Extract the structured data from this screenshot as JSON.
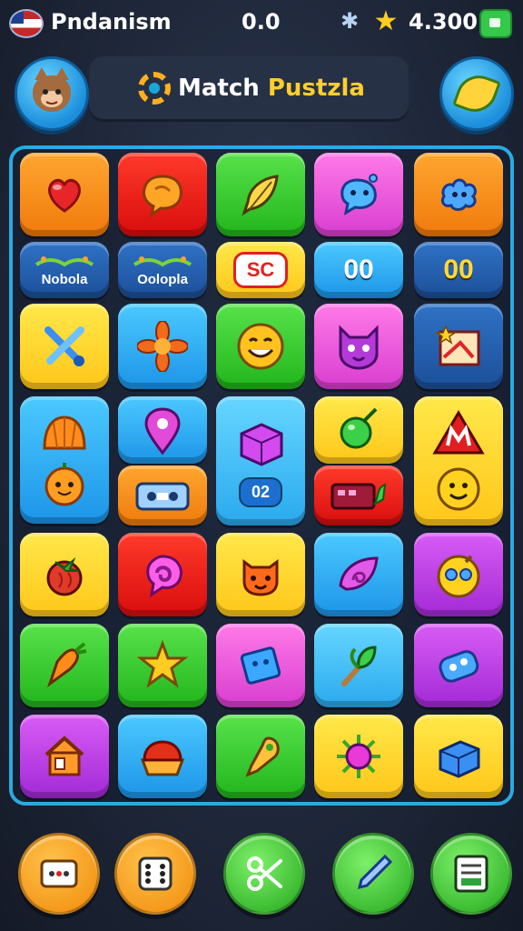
{
  "status": {
    "app_name": "Pndanism",
    "center_value": "0.0",
    "score": "4.300"
  },
  "header": {
    "title_part1": "Match",
    "title_part2": "Pustzla"
  },
  "board": {
    "row2": [
      "Nobola",
      "Oolopla",
      "SC",
      "00",
      "00"
    ],
    "counter_label": "02"
  },
  "icons": {
    "flag": "flag-icon",
    "status_fan": "fan-icon",
    "status_star": "star-icon",
    "battery": "battery-icon",
    "profile": "cat-avatar-icon",
    "hint": "leaf-hint-icon",
    "bottom": [
      "message-icon",
      "dice-icon",
      "scissors-icon",
      "pencil-icon",
      "card-icon"
    ]
  },
  "colors": {
    "board_border": "#2ba9e0",
    "accent_yellow": "#ffcf2e",
    "background": "#1b2334"
  }
}
